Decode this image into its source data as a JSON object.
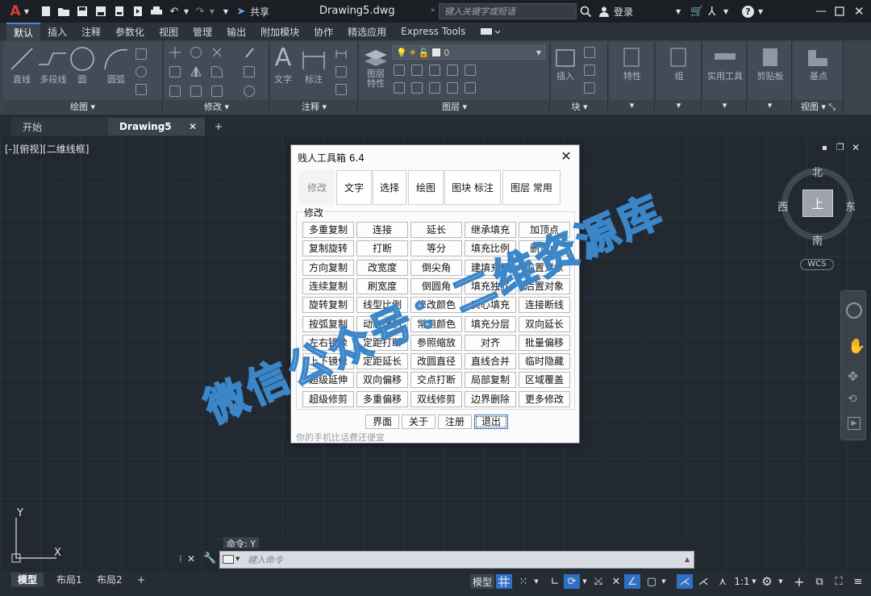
{
  "titlebar": {
    "app_icon": "A",
    "document_title": "Drawing5.dwg",
    "share_label": "共享",
    "search_placeholder": "键入关键字或短语",
    "login_label": "登录",
    "help_icon": "?"
  },
  "ribbon_tabs": [
    "默认",
    "插入",
    "注释",
    "参数化",
    "视图",
    "管理",
    "输出",
    "附加模块",
    "协作",
    "精选应用",
    "Express Tools"
  ],
  "ribbon_panels": {
    "draw": {
      "title": "绘图",
      "tools": [
        "直线",
        "多段线",
        "圆",
        "圆弧"
      ]
    },
    "modify": {
      "title": "修改"
    },
    "annotation": {
      "title": "注释",
      "tools": [
        "文字",
        "标注"
      ]
    },
    "layers": {
      "title": "图层",
      "tools": [
        "图层\n特性"
      ],
      "layer_value": "0"
    },
    "block": {
      "title": "块",
      "tools": [
        "插入"
      ]
    },
    "properties": {
      "label": "特性"
    },
    "groups": {
      "label": "组"
    },
    "utilities": {
      "label": "实用工具"
    },
    "clipboard": {
      "label": "剪贴板"
    },
    "view": {
      "title": "视图",
      "tools": [
        "基点"
      ]
    }
  },
  "file_tabs": {
    "start": "开始",
    "active": "Drawing5",
    "add": "+"
  },
  "viewport": {
    "label": "[-][俯视][二维线框]"
  },
  "viewcube": {
    "north": "北",
    "south": "南",
    "east": "东",
    "west": "西",
    "face": "上",
    "wcs": "WCS"
  },
  "dialog": {
    "title": "贱人工具箱 6.4",
    "categories": [
      "修改",
      "文字",
      "选择",
      "绘图",
      "图块  标注",
      "图层  常用"
    ],
    "group_label": "修改",
    "functions": [
      [
        "多重复制",
        "连接",
        "延长",
        "继承填充",
        "加顶点"
      ],
      [
        "复制旋转",
        "打断",
        "等分",
        "填充比例",
        "删顶点"
      ],
      [
        "方向复制",
        "改宽度",
        "倒尖角",
        "建填充框",
        "前置对象"
      ],
      [
        "连续复制",
        "刷宽度",
        "倒圆角",
        "填充独立",
        "后置对象"
      ],
      [
        "旋转复制",
        "线型比例",
        "修改颜色",
        "实心填充",
        "连接断线"
      ],
      [
        "按弧复制",
        "动态比例",
        "常用颜色",
        "填充分层",
        "双向延长"
      ],
      [
        "左右镜像",
        "定距打断",
        "参照缩放",
        "对齐",
        "批量偏移"
      ],
      [
        "上下镜像",
        "定距延长",
        "改圆直径",
        "直线合并",
        "临时隐藏"
      ],
      [
        "超级延伸",
        "双向偏移",
        "交点打断",
        "局部复制",
        "区域覆盖"
      ],
      [
        "超级修剪",
        "多重偏移",
        "双线修剪",
        "边界删除",
        "更多修改"
      ]
    ],
    "bottom_buttons": [
      "界面",
      "关于",
      "注册",
      "退出"
    ],
    "status_text": "你的手机比话费还便宜"
  },
  "watermark": "微信公众号：二维资源库",
  "ucs": {
    "x": "X",
    "y": "Y"
  },
  "command": {
    "history": "命令: Y",
    "placeholder": "键入命令"
  },
  "layout_tabs": [
    "模型",
    "布局1",
    "布局2"
  ],
  "statusbar": {
    "model_label": "模型",
    "scale": "1:1"
  },
  "colors": {
    "accent": "#4f8ad0",
    "canvas": "#212830",
    "ribbon": "#3b434d",
    "dialog_bg": "#fbfbfb"
  }
}
